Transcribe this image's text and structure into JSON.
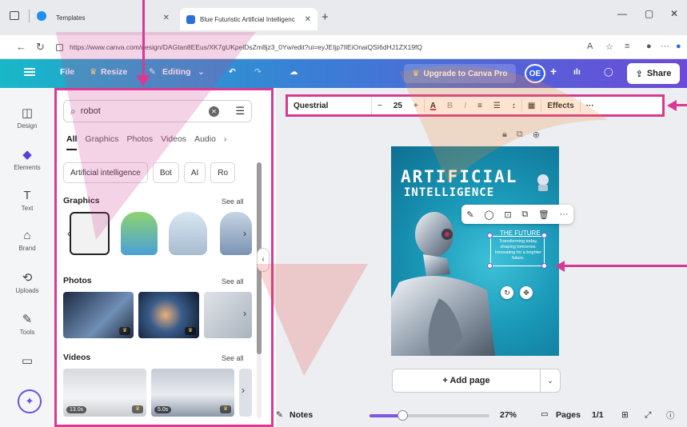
{
  "browser": {
    "tabs": [
      {
        "title": "Templates"
      },
      {
        "title": "Blue Futuristic Artificial Intelligenc"
      }
    ],
    "url": "https://www.canva.com/design/DAGtan8EEus/XK7gUKpelDsZm8jz3_0Yw/edit?ui=eyJEIjp7IlEiOnaiQSI6dHJ1ZX19fQ",
    "new_tab": "+",
    "window_controls": [
      "—",
      "▢",
      "✕"
    ]
  },
  "header": {
    "file": "File",
    "resize": "Resize",
    "editing": "Editing",
    "upgrade": "Upgrade to Canva Pro",
    "avatar": "OE",
    "plus": "+",
    "share": "Share"
  },
  "rail": {
    "items": [
      {
        "label": "Design",
        "icon": "design-icon"
      },
      {
        "label": "Elements",
        "icon": "elements-icon"
      },
      {
        "label": "Text",
        "icon": "text-icon"
      },
      {
        "label": "Brand",
        "icon": "brand-icon"
      },
      {
        "label": "Uploads",
        "icon": "uploads-icon"
      },
      {
        "label": "Tools",
        "icon": "tools-icon"
      },
      {
        "label": "",
        "icon": "folder-icon"
      }
    ]
  },
  "panel": {
    "search_value": "robot",
    "tabs": [
      "All",
      "Graphics",
      "Photos",
      "Videos",
      "Audio"
    ],
    "chips": [
      "Artificial intelligence",
      "Bot",
      "AI",
      "Ro"
    ],
    "sections": {
      "graphics": {
        "title": "Graphics",
        "see_all": "See all"
      },
      "photos": {
        "title": "Photos",
        "see_all": "See all"
      },
      "videos": {
        "title": "Videos",
        "see_all": "See all"
      }
    },
    "video_durations": [
      "13.0s",
      "5.0s"
    ]
  },
  "toolbar": {
    "font": "Questrial",
    "minus": "−",
    "size": "25",
    "plus": "+",
    "effects": "Effects",
    "more": "···"
  },
  "poster": {
    "title1": "ARTIFICIAL",
    "title2": "INTELLIGENCE",
    "future": "THE FUTURE",
    "sub": "Transforming today, shaping tomorrow. Innovating for a brighter future."
  },
  "editor": {
    "add_page": "+ Add page",
    "notes": "Notes",
    "zoom": "27%",
    "zoom_fraction": 0.27,
    "pages_label": "Pages",
    "pages_count": "1/1"
  },
  "colors": {
    "accent": "#d63a93",
    "brand": "#7a57e8"
  }
}
